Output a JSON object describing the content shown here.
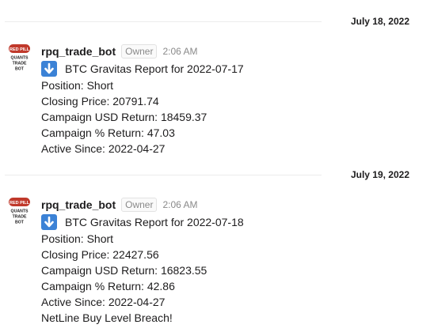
{
  "feed": {
    "sections": [
      {
        "date": "July 18, 2022",
        "message": {
          "sender": "rpq_trade_bot",
          "role": "Owner",
          "time": "2:06 AM",
          "icon": "down-arrow-icon",
          "title": "BTC Gravitas Report for 2022-07-17",
          "lines": [
            "Position: Short",
            "Closing Price: 20791.74",
            "Campaign USD Return: 18459.37",
            "Campaign % Return: 47.03",
            "Active Since: 2022-04-27"
          ]
        }
      },
      {
        "date": "July 19, 2022",
        "message": {
          "sender": "rpq_trade_bot",
          "role": "Owner",
          "time": "2:06 AM",
          "icon": "down-arrow-icon",
          "title": "BTC Gravitas Report for 2022-07-18",
          "lines": [
            "Position: Short",
            "Closing Price: 22427.56",
            "Campaign USD Return: 16823.55",
            "Campaign % Return: 42.86",
            "Active Since: 2022-04-27",
            "NetLine Buy Level Breach!"
          ]
        }
      }
    ]
  },
  "avatar": {
    "pill_text": "RED PILL",
    "line1": "QUANTS",
    "line2": "TRADE",
    "line3": "BOT",
    "pill_color": "#c0392b"
  },
  "colors": {
    "icon_blue": "#3b82d6",
    "divider": "#ececec",
    "muted": "#8a8a8a"
  }
}
